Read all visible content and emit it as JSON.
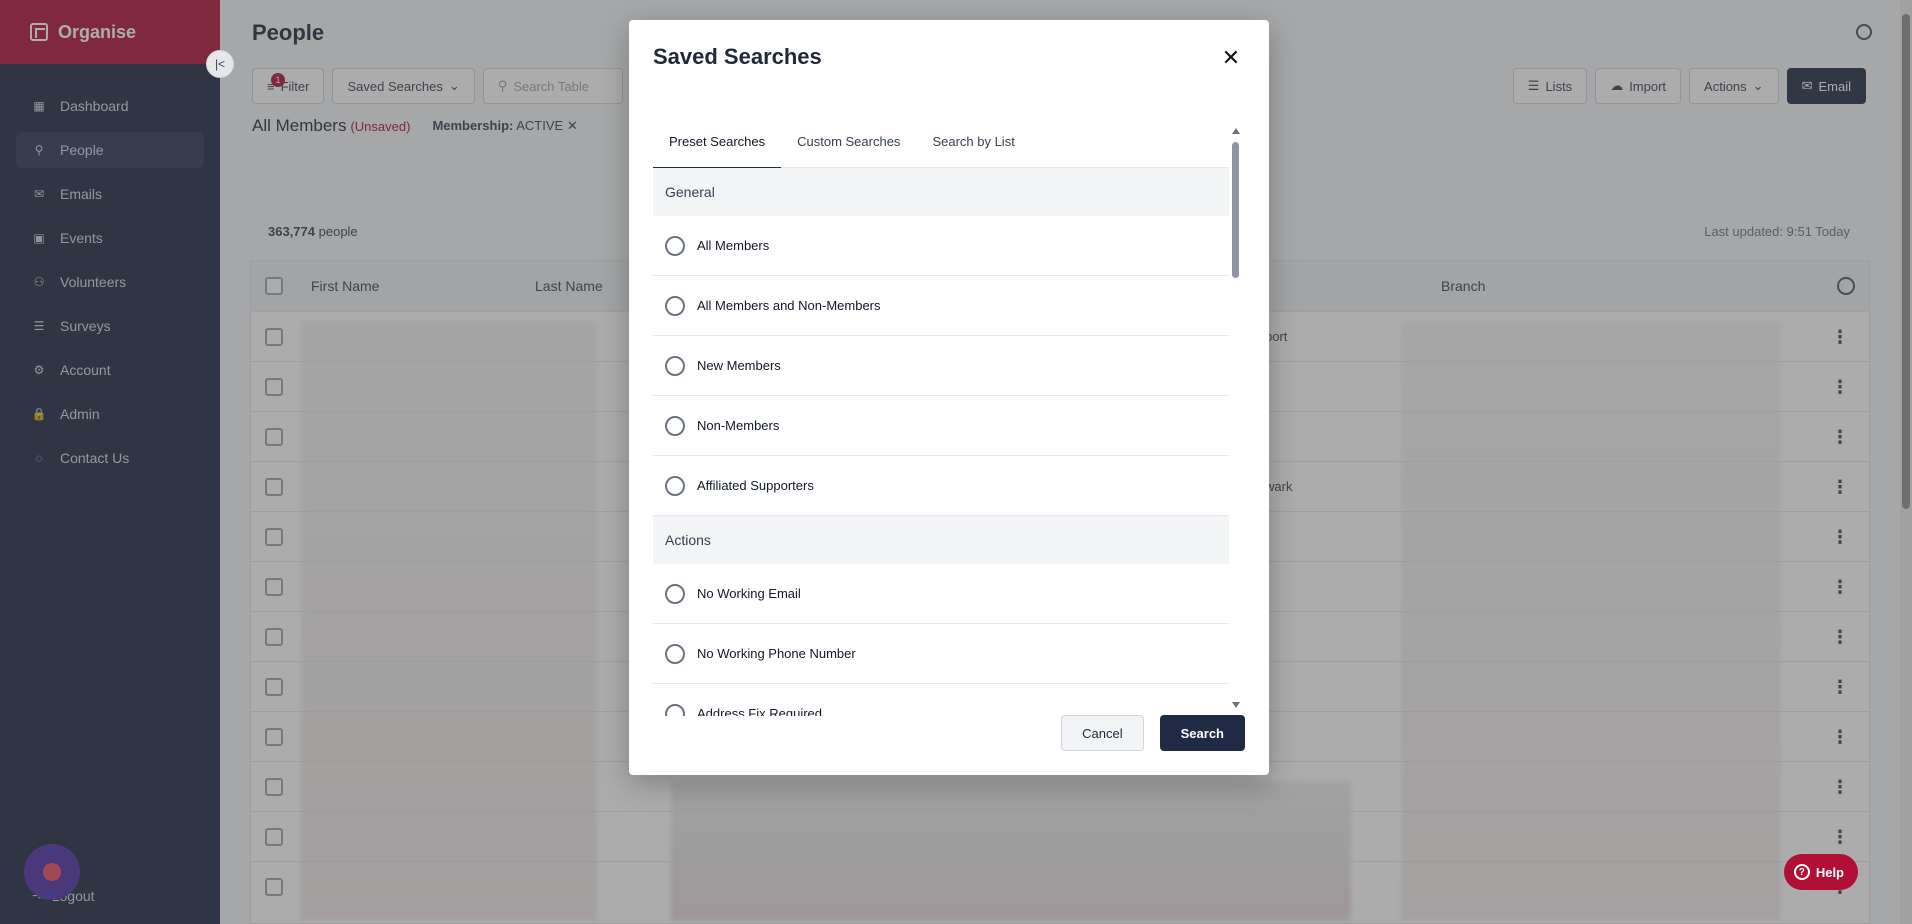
{
  "app": {
    "brand": "Organise"
  },
  "sidebar": {
    "items": [
      {
        "label": "Dashboard",
        "icon": "dashboard-icon",
        "glyph": "▦"
      },
      {
        "label": "People",
        "icon": "person-icon",
        "glyph": "⚲"
      },
      {
        "label": "Emails",
        "icon": "mail-icon",
        "glyph": "✉"
      },
      {
        "label": "Events",
        "icon": "calendar-icon",
        "glyph": "▣"
      },
      {
        "label": "Volunteers",
        "icon": "group-icon",
        "glyph": "⚇"
      },
      {
        "label": "Surveys",
        "icon": "survey-icon",
        "glyph": "☰"
      },
      {
        "label": "Account",
        "icon": "gear-icon",
        "glyph": "⚙"
      },
      {
        "label": "Admin",
        "icon": "lock-icon",
        "glyph": "🔒"
      },
      {
        "label": "Contact Us",
        "icon": "chat-icon",
        "glyph": "◌"
      }
    ],
    "active_index": 1,
    "logout": "Logout"
  },
  "page": {
    "title": "People",
    "toolbar": {
      "filter_label": "Filter",
      "filter_badge": "1",
      "saved_searches_label": "Saved Searches",
      "search_placeholder": "Search Table",
      "lists_label": "Lists",
      "import_label": "Import",
      "actions_label": "Actions",
      "email_label": "Email"
    },
    "subbar": {
      "title": "All Members",
      "unsaved": "(Unsaved)",
      "chip_key": "Membership:",
      "chip_value": "ACTIVE"
    },
    "count_number": "363,774",
    "count_suffix": "people",
    "last_updated": "Last updated: 9:51 Today",
    "table": {
      "headers": {
        "first_name": "First Name",
        "last_name": "Last Name",
        "branch": "Branch"
      },
      "visible_fragments": [
        "port",
        "wark"
      ]
    }
  },
  "modal": {
    "title": "Saved Searches",
    "tabs": [
      "Preset Searches",
      "Custom Searches",
      "Search by List"
    ],
    "active_tab": 0,
    "groups": [
      {
        "name": "General",
        "options": [
          "All Members",
          "All Members and Non-Members",
          "New Members",
          "Non-Members",
          "Affiliated Supporters"
        ]
      },
      {
        "name": "Actions",
        "options": [
          "No Working Email",
          "No Working Phone Number",
          "Address Fix Required"
        ]
      }
    ],
    "cancel_label": "Cancel",
    "search_label": "Search"
  },
  "help": {
    "label": "Help"
  },
  "colors": {
    "brand": "#b01035",
    "sidebar": "#1c2740",
    "primary_button": "#1f2a44"
  }
}
